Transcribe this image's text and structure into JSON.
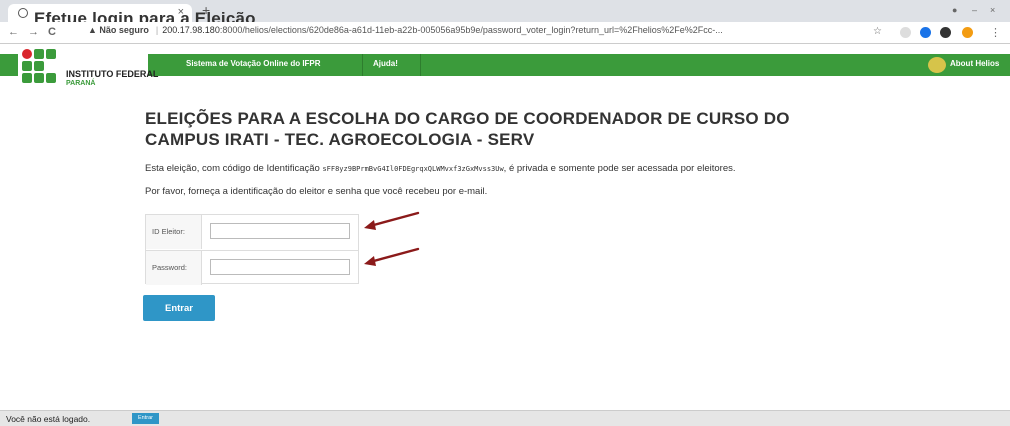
{
  "browser": {
    "tab_title": "Efetue login para a Eleição",
    "tab_close": "×",
    "new_tab": "+",
    "back": "←",
    "forward": "→",
    "reload": "C",
    "security_label": "▲ Não seguro",
    "url_host": "200.17.98.180",
    "url_rest": ":8000/helios/elections/620de86a-a61d-11eb-a22b-005056a95b9e/password_voter_login?return_url=%2Fhelios%2Fe%2Fcc-...",
    "star": "☆"
  },
  "header": {
    "org_name": "INSTITUTO FEDERAL",
    "org_state": "PARANÁ",
    "nav_system": "Sistema de Votação Online do IFPR",
    "nav_help": "Ajuda!",
    "nav_about": "About Helios"
  },
  "main": {
    "title": "ELEIÇÕES PARA A ESCOLHA DO CARGO DE COORDENADOR DE CURSO DO CAMPUS IRATI - TEC. AGROECOLOGIA - SERV",
    "desc_prefix": "Esta eleição, com código de Identificação ",
    "election_code": "sFF8yz9BPrmBvG4Il0FDEgrqxQLWMvxf3zGxMvss3Uw",
    "desc_suffix": ", é privada e somente pode ser acessada por eleitores.",
    "instructions": "Por favor, forneça a identificação do eleitor e senha que você recebeu por e-mail.",
    "voter_id_label": "ID Eleitor:",
    "voter_id_value": "",
    "password_label": "Password:",
    "password_value": "",
    "submit_label": "Entrar"
  },
  "footer": {
    "status": "Você não está logado.",
    "login_label": "Entrar"
  },
  "colors": {
    "brand_green": "#3b9b3b",
    "logo_red": "#d9262c",
    "button_blue": "#2f96c7",
    "arrow": "#8b1a1a"
  }
}
